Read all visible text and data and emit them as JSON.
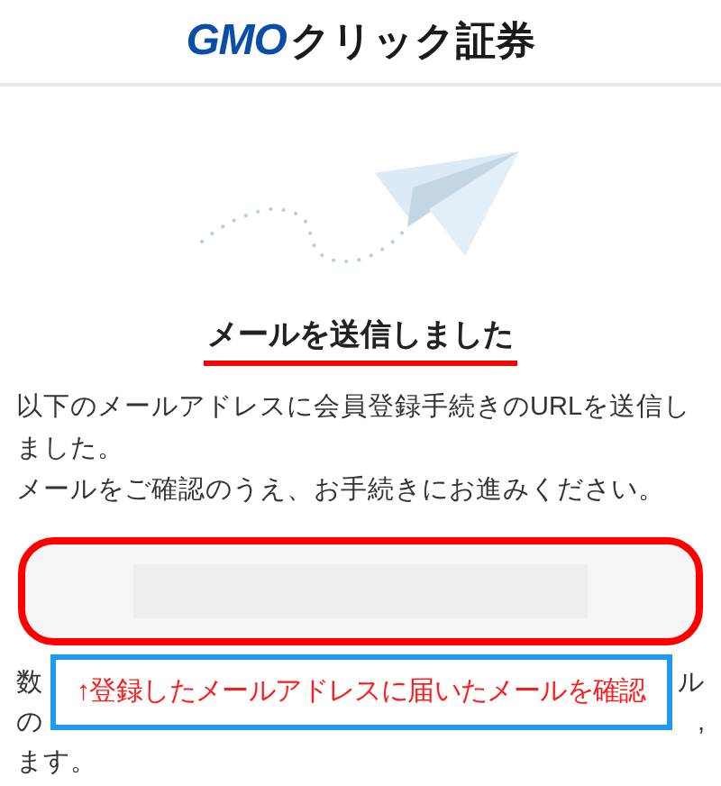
{
  "header": {
    "logo_latin": "GMO",
    "logo_kana": "クリック証券"
  },
  "title": "メールを送信しました",
  "message": [
    "以下のメールアドレスに会員登録手続きのURLを送信しました。",
    "メールをご確認のうえ、お手続きにお進みください。"
  ],
  "note_fragments": [
    {
      "left": "数",
      "right": "ル"
    },
    {
      "left": "の",
      "right": ","
    },
    {
      "left": "ます。"
    }
  ],
  "callout": "↑登録したメールアドレスに届いたメールを確認"
}
